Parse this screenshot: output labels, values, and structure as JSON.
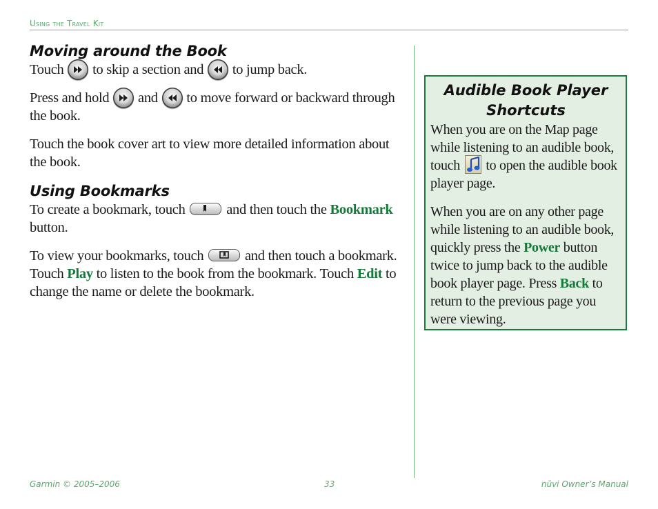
{
  "running_head": "Using the Travel Kit",
  "sections": {
    "moving": {
      "title": "Moving around the Book",
      "p1": {
        "a": "Touch",
        "b": "to skip a section and",
        "c": "to jump back."
      },
      "p2": {
        "a": "Press and hold",
        "b": "and",
        "c": "to move forward or backward through the book."
      },
      "p3": "Touch the book cover art to view more detailed information about the book."
    },
    "bookmarks": {
      "title": "Using Bookmarks",
      "p1": {
        "a": "To create a bookmark, touch",
        "b": "and then touch the",
        "kw": "Bookmark",
        "c": "button."
      },
      "p2": {
        "a": "To view your bookmarks, touch",
        "b": "and then touch a bookmark. Touch",
        "kw1": "Play",
        "c": "to listen to the book from the bookmark. Touch",
        "kw2": "Edit",
        "d": "to change the name or delete the bookmark."
      }
    }
  },
  "sidebar": {
    "title": "Audible Book Player Shortcuts",
    "p1": {
      "a": "When you are on the Map page while listening to an audible book, touch",
      "b": "to open the audible book player page."
    },
    "p2": {
      "a": "When you are on any other page while listening to an audible book, quickly press the",
      "kw1": "Power",
      "b": "button twice to jump back to the audible book player page. Press",
      "kw2": "Back",
      "c": "to return to the previous page you were viewing."
    }
  },
  "icons": {
    "skip_forward": "fast-forward-icon",
    "skip_back": "rewind-icon",
    "bookmark_add": "bookmark-icon",
    "bookmark_view": "bookmark-list-icon",
    "music": "music-note-icon"
  },
  "colors": {
    "accent_green": "#137a3a",
    "rule_green": "#6db37c",
    "box_bg": "#e3efe2"
  },
  "footer": {
    "left": "Garmin © 2005–2006",
    "center": "33",
    "right": "nüvi Owner’s Manual"
  }
}
